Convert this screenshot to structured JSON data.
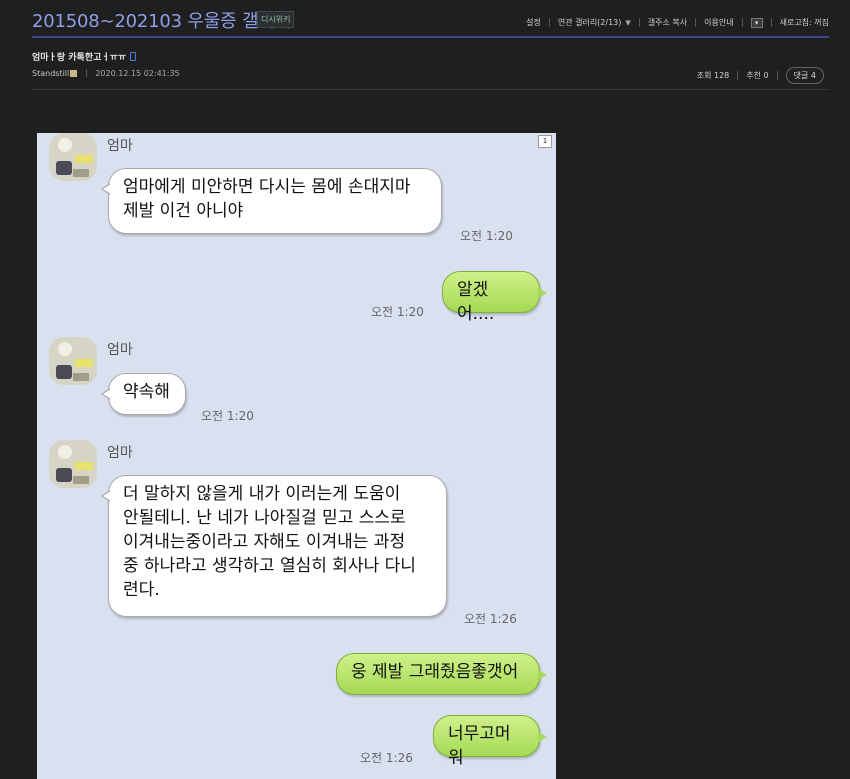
{
  "gallery": {
    "title": "201508~202103 우울증 갤러리",
    "wiki_badge": "디시위키"
  },
  "topnav": {
    "settings": "설정",
    "related": "연관 갤러리(2/13)",
    "copy_url": "갤주소 복사",
    "guide": "이용안내",
    "refresh": "새로고침: 꺼짐"
  },
  "post": {
    "title": "엄마ㅏ랑 카톡한고ㅓㅠㅠ",
    "author": "Standstill",
    "date": "2020.12.15 02:41:35",
    "views": "조회 128",
    "recommend": "추천 0",
    "comments": "댓글 4"
  },
  "chat": {
    "page": "1",
    "messages": [
      {
        "side": "left",
        "name": "엄마",
        "text": "엄마에게 미안하면 다시는 몸에 손대지마\n제발 이건 아니야",
        "time": "오전 1:20"
      },
      {
        "side": "right",
        "text": "알겠어....",
        "time": "오전 1:20"
      },
      {
        "side": "left",
        "name": "엄마",
        "text": "약속해",
        "time": "오전 1:20"
      },
      {
        "side": "left",
        "name": "엄마",
        "text": "더 말하지 않을게  내가 이러는게 도움이\n안될테니.  난 네가 나아질걸 믿고 스스로\n이겨내는중이라고 자해도 이겨내는 과정\n중 하나라고 생각하고 열심히 회사나 다니\n련다.",
        "time": "오전 1:26"
      },
      {
        "side": "right",
        "text": "웅 제발 그래줬음좋갯어",
        "time": ""
      },
      {
        "side": "right",
        "text": "너무고머워",
        "time": "오전 1:26"
      }
    ]
  },
  "colors": {
    "background": "#1f1f1f",
    "gallery_title": "#8f9ee8",
    "chat_bg": "#d9e0ef",
    "bubble_right": "#a5da54"
  }
}
